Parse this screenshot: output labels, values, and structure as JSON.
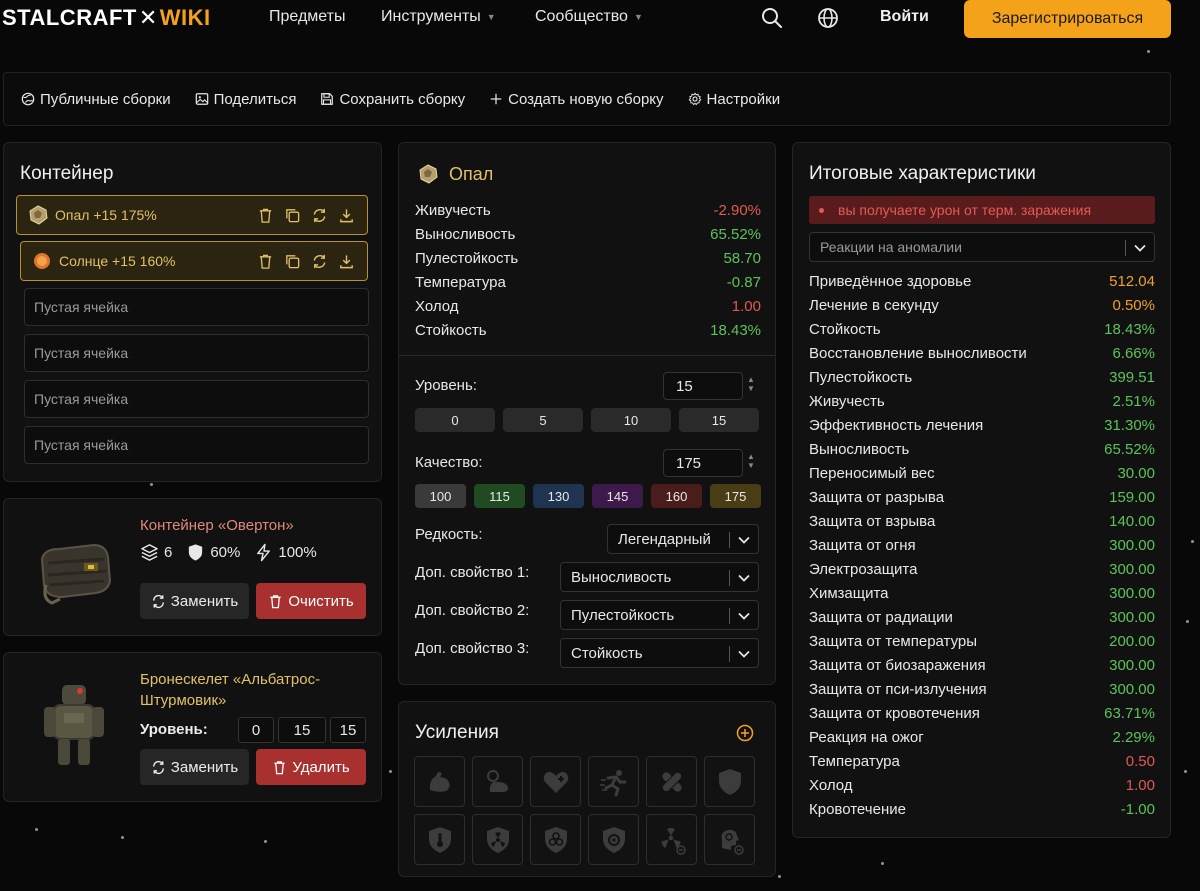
{
  "nav": {
    "logo_left": "STALCRAFT",
    "logo_x": "✕",
    "logo_right": "WIKI",
    "items": [
      "Предметы",
      "Инструменты",
      "Сообщество"
    ],
    "login": "Войти",
    "register": "Зарегистрироваться",
    "icons": [
      "search-icon",
      "globe-icon"
    ]
  },
  "toolbar": {
    "items": [
      "Публичные сборки",
      "Поделиться",
      "Сохранить сборку",
      "Создать новую сборку",
      "Настройки"
    ]
  },
  "container": {
    "title": "Контейнер",
    "filled": [
      {
        "label": "Опал +15 175%"
      },
      {
        "label": "Солнце +15 160%"
      }
    ],
    "empty_label": "Пустая ячейка",
    "empty_count": 4
  },
  "card1": {
    "name": "Контейнер «Овертон»",
    "name_color": "#e0897a",
    "slots": "6",
    "protection": "60%",
    "efficiency": "100%",
    "replace": "Заменить",
    "clear": "Очистить"
  },
  "card2": {
    "name_line1": "Бронескелет «Альбатрос-",
    "name_line2": "Штурмовик»",
    "name_color": "#e2c06a",
    "level_label": "Уровень:",
    "levels": [
      "0",
      "15",
      "15"
    ],
    "replace": "Заменить",
    "delete": "Удалить"
  },
  "artifact": {
    "name": "Опал",
    "stats": [
      {
        "label": "Живучесть",
        "value": "-2.90%",
        "color": "#e05a52"
      },
      {
        "label": "Выносливость",
        "value": "65.52%",
        "color": "#5cc25c"
      },
      {
        "label": "Пулестойкость",
        "value": "58.70",
        "color": "#5cc25c"
      },
      {
        "label": "Температура",
        "value": "-0.87",
        "color": "#5cc25c"
      },
      {
        "label": "Холод",
        "value": "1.00",
        "color": "#e05a52"
      },
      {
        "label": "Стойкость",
        "value": "18.43%",
        "color": "#5cc25c"
      }
    ],
    "level_label": "Уровень:",
    "level_value": "15",
    "level_chips": [
      "0",
      "5",
      "10",
      "15"
    ],
    "quality_label": "Качество:",
    "quality_value": "175",
    "quality_chips": [
      {
        "label": "100",
        "color": "#3a3a3a"
      },
      {
        "label": "115",
        "color": "#1f4a22"
      },
      {
        "label": "130",
        "color": "#1f3450"
      },
      {
        "label": "145",
        "color": "#3e1a4a"
      },
      {
        "label": "160",
        "color": "#4a1c1c"
      },
      {
        "label": "175",
        "color": "#4a3c14"
      }
    ],
    "rarity_label": "Редкость:",
    "rarity_value": "Легендарный",
    "extra1_label": "Доп. свойство 1:",
    "extra1_value": "Выносливость",
    "extra2_label": "Доп. свойство 2:",
    "extra2_value": "Пулестойкость",
    "extra3_label": "Доп. свойство 3:",
    "extra3_value": "Стойкость"
  },
  "boosts": {
    "title": "Усиления",
    "icons": [
      "strength-icon",
      "stamina-time-icon",
      "heal-heart-icon",
      "run-icon",
      "bandage-icon",
      "shield-icon",
      "thermal-icon",
      "radiation-shield-icon",
      "biohazard-icon",
      "psi-shield-icon",
      "radiation-minus-icon",
      "psi-minus-icon"
    ]
  },
  "totals": {
    "title": "Итоговые характеристики",
    "warning": "вы получаете урон от терм. заражения",
    "select_placeholder": "Реакции на аномалии",
    "stats": [
      {
        "label": "Приведённое здоровье",
        "value": "512.04",
        "color": "#f0a030"
      },
      {
        "label": "Лечение в секунду",
        "value": "0.50%",
        "color": "#f0a030"
      },
      {
        "label": "Стойкость",
        "value": "18.43%",
        "color": "#5cc25c"
      },
      {
        "label": "Восстановление выносливости",
        "value": "6.66%",
        "color": "#5cc25c"
      },
      {
        "label": "Пулестойкость",
        "value": "399.51",
        "color": "#5cc25c"
      },
      {
        "label": "Живучесть",
        "value": "2.51%",
        "color": "#5cc25c"
      },
      {
        "label": "Эффективность лечения",
        "value": "31.30%",
        "color": "#5cc25c"
      },
      {
        "label": "Выносливость",
        "value": "65.52%",
        "color": "#5cc25c"
      },
      {
        "label": "Переносимый вес",
        "value": "30.00",
        "color": "#5cc25c"
      },
      {
        "label": "Защита от разрыва",
        "value": "159.00",
        "color": "#5cc25c"
      },
      {
        "label": "Защита от взрыва",
        "value": "140.00",
        "color": "#5cc25c"
      },
      {
        "label": "Защита от огня",
        "value": "300.00",
        "color": "#5cc25c"
      },
      {
        "label": "Электрозащита",
        "value": "300.00",
        "color": "#5cc25c"
      },
      {
        "label": "Химзащита",
        "value": "300.00",
        "color": "#5cc25c"
      },
      {
        "label": "Защита от радиации",
        "value": "300.00",
        "color": "#5cc25c"
      },
      {
        "label": "Защита от температуры",
        "value": "200.00",
        "color": "#5cc25c"
      },
      {
        "label": "Защита от биозаражения",
        "value": "300.00",
        "color": "#5cc25c"
      },
      {
        "label": "Защита от пси-излучения",
        "value": "300.00",
        "color": "#5cc25c"
      },
      {
        "label": "Защита от кровотечения",
        "value": "63.71%",
        "color": "#5cc25c"
      },
      {
        "label": "Реакция на ожог",
        "value": "2.29%",
        "color": "#5cc25c"
      },
      {
        "label": "Температура",
        "value": "0.50",
        "color": "#e05a52"
      },
      {
        "label": "Холод",
        "value": "1.00",
        "color": "#e05a52"
      },
      {
        "label": "Кровотечение",
        "value": "-1.00",
        "color": "#5cc25c"
      }
    ]
  }
}
